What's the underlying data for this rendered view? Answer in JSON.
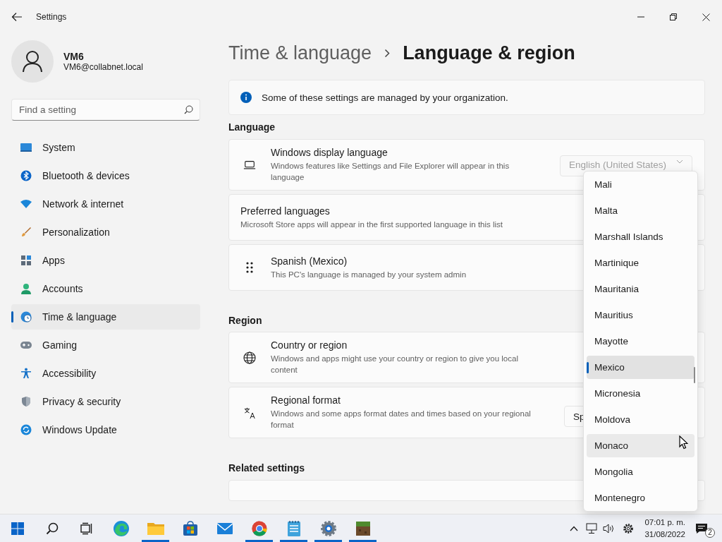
{
  "window": {
    "title": "Settings"
  },
  "user": {
    "name": "VM6",
    "email": "VM6@collabnet.local"
  },
  "search": {
    "placeholder": "Find a setting"
  },
  "sidebar": {
    "items": [
      {
        "label": "System",
        "selected": false
      },
      {
        "label": "Bluetooth & devices",
        "selected": false
      },
      {
        "label": "Network & internet",
        "selected": false
      },
      {
        "label": "Personalization",
        "selected": false
      },
      {
        "label": "Apps",
        "selected": false
      },
      {
        "label": "Accounts",
        "selected": false
      },
      {
        "label": "Time & language",
        "selected": true
      },
      {
        "label": "Gaming",
        "selected": false
      },
      {
        "label": "Accessibility",
        "selected": false
      },
      {
        "label": "Privacy & security",
        "selected": false
      },
      {
        "label": "Windows Update",
        "selected": false
      }
    ]
  },
  "breadcrumb": {
    "parent": "Time & language",
    "current": "Language & region"
  },
  "notice": {
    "text": "Some of these settings are managed by your organization."
  },
  "sections": [
    {
      "heading": "Language",
      "cards": [
        {
          "title": "Windows display language",
          "description": "Windows features like Settings and File Explorer will appear in this language",
          "dropdown": {
            "value": "English (United States)",
            "disabled": true
          }
        },
        {
          "title": "Preferred languages",
          "description": "Microsoft Store apps will appear in the first supported language in this list"
        },
        {
          "title": "Spanish (Mexico)",
          "description": "This PC's language is managed by your system admin"
        }
      ]
    },
    {
      "heading": "Region",
      "cards": [
        {
          "title": "Country or region",
          "description": "Windows and apps might use your country or region to give you local content"
        },
        {
          "title": "Regional format",
          "description": "Windows and some apps format dates and times based on your regional format",
          "dropdown": {
            "value": "Sp",
            "disabled": false
          }
        }
      ]
    },
    {
      "heading": "Related settings"
    }
  ],
  "country_list": {
    "items": [
      {
        "label": "Mali",
        "selected": false,
        "hovered": false
      },
      {
        "label": "Malta",
        "selected": false,
        "hovered": false
      },
      {
        "label": "Marshall Islands",
        "selected": false,
        "hovered": false
      },
      {
        "label": "Martinique",
        "selected": false,
        "hovered": false
      },
      {
        "label": "Mauritania",
        "selected": false,
        "hovered": false
      },
      {
        "label": "Mauritius",
        "selected": false,
        "hovered": false
      },
      {
        "label": "Mayotte",
        "selected": false,
        "hovered": false
      },
      {
        "label": "Mexico",
        "selected": true,
        "hovered": false
      },
      {
        "label": "Micronesia",
        "selected": false,
        "hovered": false
      },
      {
        "label": "Moldova",
        "selected": false,
        "hovered": false
      },
      {
        "label": "Monaco",
        "selected": false,
        "hovered": true
      },
      {
        "label": "Mongolia",
        "selected": false,
        "hovered": false
      },
      {
        "label": "Montenegro",
        "selected": false,
        "hovered": false
      }
    ]
  },
  "taskbar": {
    "apps": [
      {
        "running": false
      },
      {
        "running": false
      },
      {
        "running": false
      },
      {
        "running": false
      },
      {
        "running": true
      },
      {
        "running": false
      },
      {
        "running": false
      },
      {
        "running": true
      },
      {
        "running": true
      },
      {
        "running": true
      },
      {
        "running": true
      }
    ],
    "clock": {
      "time": "07:01 p. m.",
      "date": "31/08/2022"
    },
    "notifications": {
      "count": "2"
    }
  }
}
